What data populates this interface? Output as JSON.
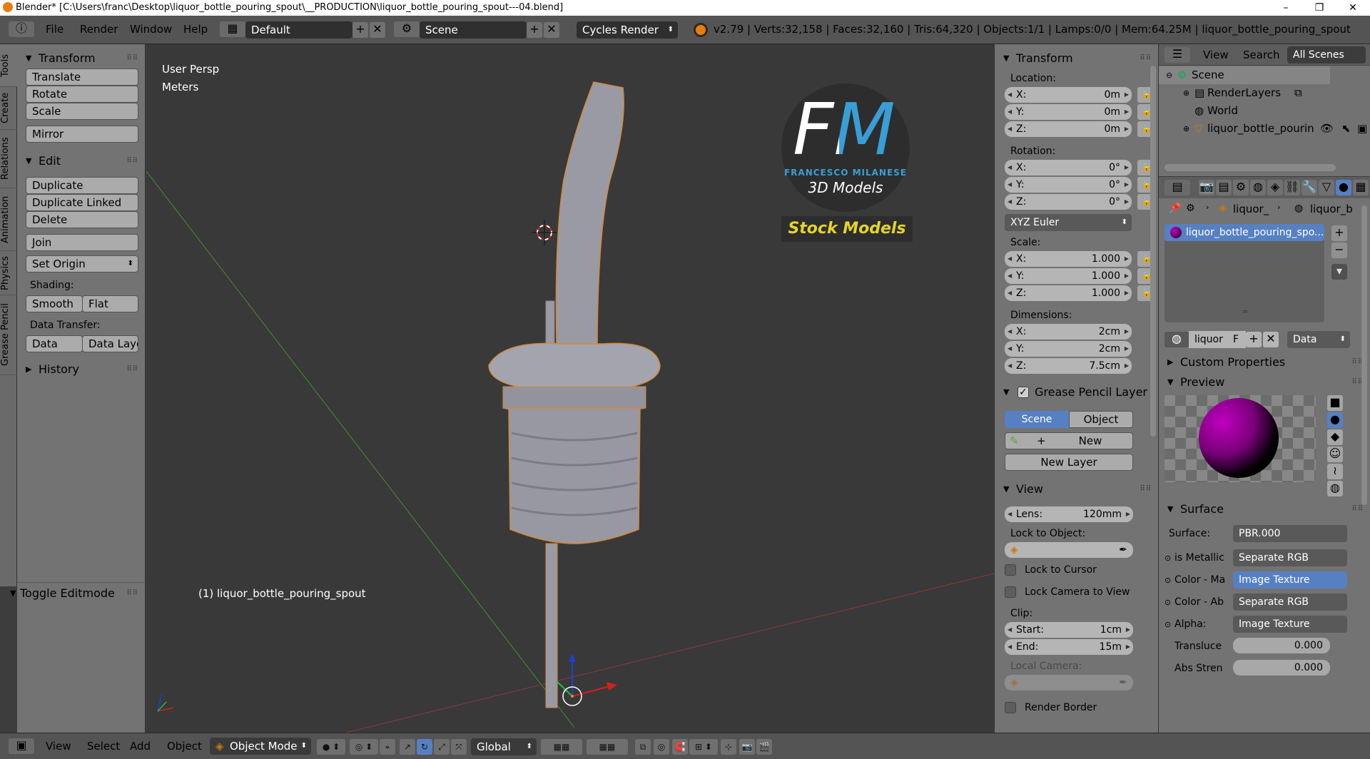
{
  "window": {
    "title": "Blender* [C:\\Users\\franc\\Desktop\\liquor_bottle_pouring_spout\\__PRODUCTION\\liquor_bottle_pouring_spout---04.blend]",
    "minimize": "–",
    "maximize": "❐",
    "close": "✕"
  },
  "header": {
    "menus": [
      "File",
      "Render",
      "Window",
      "Help"
    ],
    "layout": "Default",
    "scene": "Scene",
    "engine": "Cycles Render",
    "stats": "v2.79 | Verts:32,158 | Faces:32,160 | Tris:64,320 | Objects:1/1 | Lamps:0/0 | Mem:64.25M | liquor_bottle_pouring_spout"
  },
  "tabs": [
    "Tools",
    "Create",
    "Relations",
    "Animation",
    "Physics",
    "Grease Pencil"
  ],
  "toolshelf": {
    "transform_title": "Transform",
    "translate": "Translate",
    "rotate": "Rotate",
    "scale": "Scale",
    "mirror": "Mirror",
    "edit_title": "Edit",
    "duplicate": "Duplicate",
    "duplicate_linked": "Duplicate Linked",
    "delete": "Delete",
    "join": "Join",
    "set_origin": "Set Origin",
    "shading_label": "Shading:",
    "smooth": "Smooth",
    "flat": "Flat",
    "data_transfer_label": "Data Transfer:",
    "data": "Data",
    "data_layout": "Data Layo",
    "history_title": "History",
    "toggle_editmode": "Toggle Editmode"
  },
  "viewport": {
    "view_name": "User Persp",
    "units": "Meters",
    "object_label": "(1) liquor_bottle_pouring_spout",
    "logo_letters": "FM",
    "logo_name": "FRANCESCO MILANESE",
    "logo_sub": "3D Models",
    "logo_banner": "Stock Models"
  },
  "npanel": {
    "transform_title": "Transform",
    "location_label": "Location:",
    "location": [
      {
        "axis": "X:",
        "value": "0m"
      },
      {
        "axis": "Y:",
        "value": "0m"
      },
      {
        "axis": "Z:",
        "value": "0m"
      }
    ],
    "rotation_label": "Rotation:",
    "rotation": [
      {
        "axis": "X:",
        "value": "0°"
      },
      {
        "axis": "Y:",
        "value": "0°"
      },
      {
        "axis": "Z:",
        "value": "0°"
      }
    ],
    "rotation_mode": "XYZ Euler",
    "scale_label": "Scale:",
    "scale": [
      {
        "axis": "X:",
        "value": "1.000"
      },
      {
        "axis": "Y:",
        "value": "1.000"
      },
      {
        "axis": "Z:",
        "value": "1.000"
      }
    ],
    "dimensions_label": "Dimensions:",
    "dimensions": [
      {
        "axis": "X:",
        "value": "2cm"
      },
      {
        "axis": "Y:",
        "value": "2cm"
      },
      {
        "axis": "Z:",
        "value": "7.5cm"
      }
    ],
    "grease_title": "Grease Pencil Layer",
    "scene_btn": "Scene",
    "object_btn": "Object",
    "new_btn": "New",
    "new_layer_btn": "New Layer",
    "view_title": "View",
    "lens_label": "Lens:",
    "lens_value": "120mm",
    "lock_to_object": "Lock to Object:",
    "lock_to_cursor": "Lock to Cursor",
    "lock_camera": "Lock Camera to View",
    "clip_label": "Clip:",
    "clip_start_label": "Start:",
    "clip_start": "1cm",
    "clip_end_label": "End:",
    "clip_end": "15m",
    "local_camera": "Local Camera:",
    "render_border": "Render Border"
  },
  "outliner": {
    "view": "View",
    "search": "Search",
    "filter": "All Scenes",
    "items": [
      "Scene",
      "RenderLayers",
      "World",
      "liquor_bottle_pouring_s"
    ]
  },
  "properties": {
    "breadcrumb": [
      "liquor_",
      "liquor_b"
    ],
    "material_slot": "liquor_bottle_pouring_spo...",
    "material_name": "liquor",
    "fake_user": "F",
    "link": "Data",
    "custom_props_title": "Custom Properties",
    "preview_title": "Preview",
    "surface_title": "Surface",
    "surface_label": "Surface:",
    "surface_value": "PBR.000",
    "inputs": [
      {
        "label": "is Metallic",
        "value": "Separate RGB"
      },
      {
        "label": "Color - Ma",
        "value": "Image Texture"
      },
      {
        "label": "Color - Ab",
        "value": "Separate RGB"
      },
      {
        "label": "Alpha:",
        "value": "Image Texture"
      }
    ],
    "translucency_label": "Transluce",
    "translucency_value": "0.000",
    "abs_strength_label": "Abs Stren",
    "abs_strength_value": "0.000"
  },
  "bottombar": {
    "menus": [
      "View",
      "Select",
      "Add",
      "Object"
    ],
    "mode": "Object Mode",
    "orientation": "Global"
  },
  "colors": {
    "viewport_bg": "#393939",
    "panel_bg": "#737373",
    "selected_blue": "#5680c2",
    "logo_blue": "#3a9ed6",
    "logo_yellow": "#e4d42a"
  }
}
